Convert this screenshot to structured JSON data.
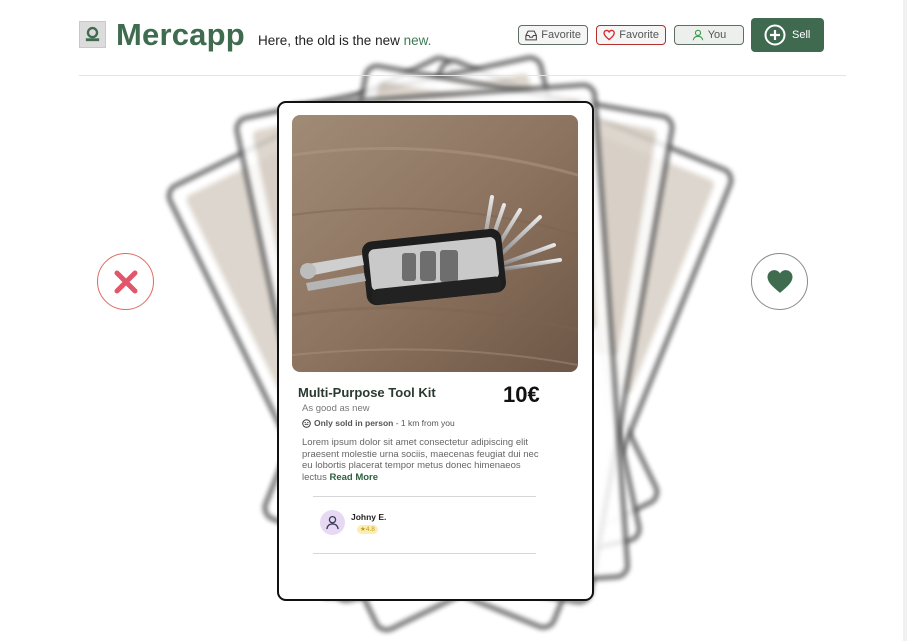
{
  "header": {
    "brand": "Mercapp",
    "tagline_main": "Here, the old is the new",
    "tagline_accent": "new.",
    "buttons": {
      "favorite_inbox": "Favorite",
      "favorite_heart": "Favorite",
      "you": "You",
      "sell": "Sell"
    }
  },
  "listing": {
    "title": "Multi-Purpose Tool Kit",
    "price": "10€",
    "condition": "As good as new",
    "delivery_bold": "Only sold in person",
    "delivery_rest": " - 1 km from you",
    "description": "Lorem ipsum dolor sit amet consectetur adipiscing elit praesent molestie urna sociis, maecenas feugiat dui nec eu lobortis placerat tempor metus donec himenaeos lectus ",
    "read_more": "Read More"
  },
  "seller": {
    "name": "Johny E.",
    "rating": "★4.8"
  },
  "icons": {
    "reject": "close-icon",
    "like": "heart-icon",
    "logo": "logo-icon"
  },
  "colors": {
    "brand_green": "#3f6b4f",
    "reject_red": "#e0566b",
    "favorite_red": "#b4302c"
  }
}
